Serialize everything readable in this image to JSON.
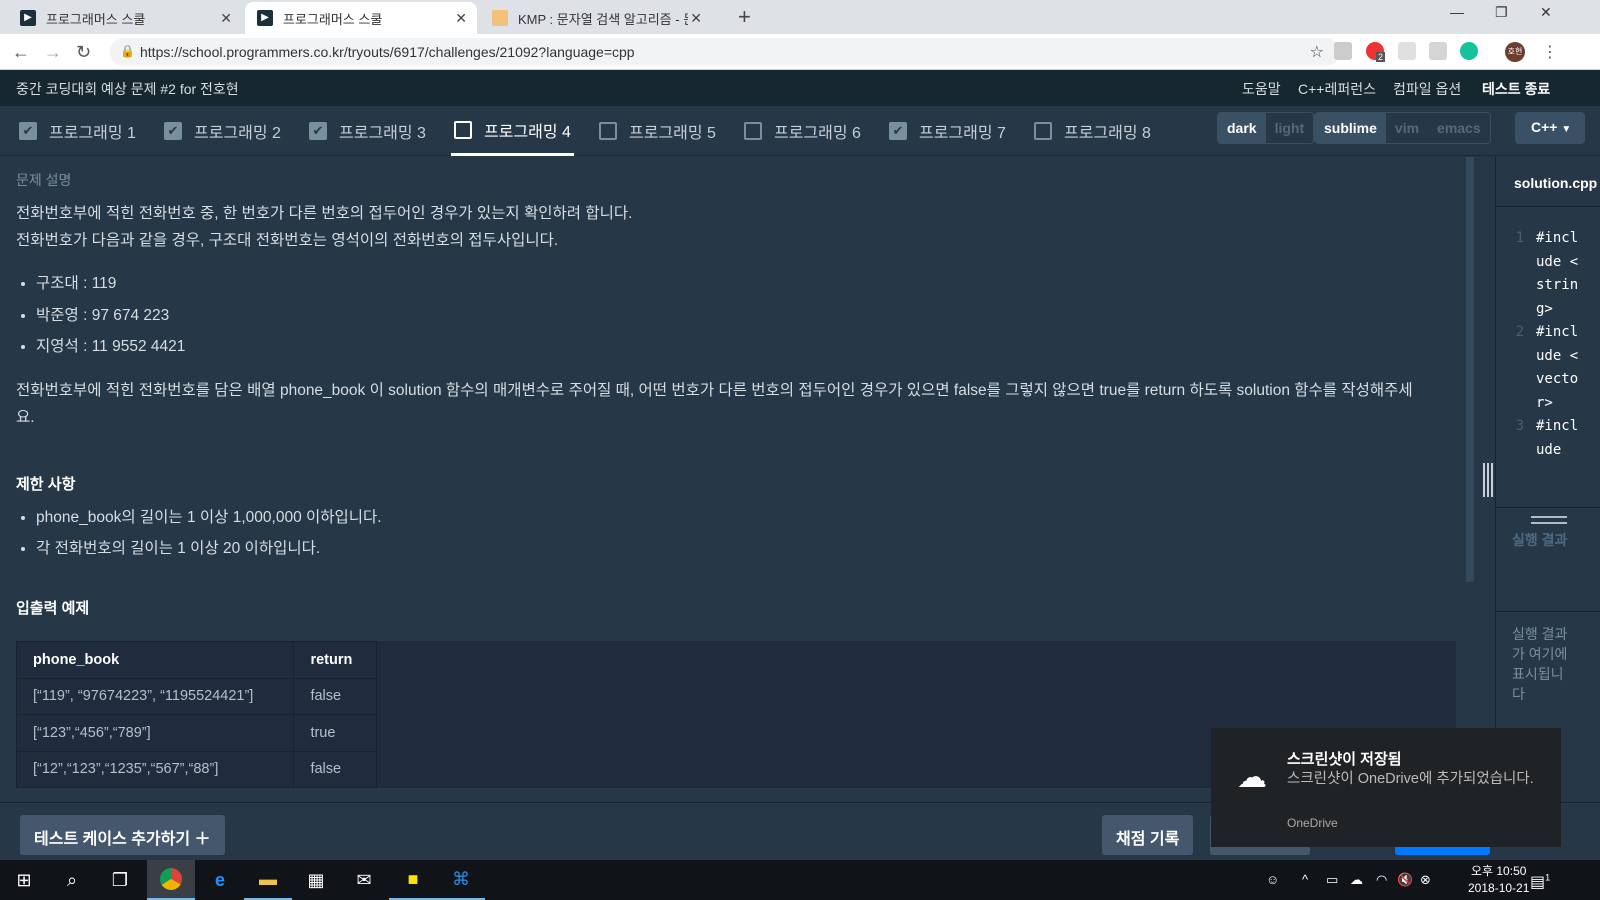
{
  "browser": {
    "tabs": [
      {
        "title": "프로그래머스 스쿨",
        "active": false
      },
      {
        "title": "프로그래머스 스쿨",
        "active": true
      },
      {
        "title": "KMP : 문자열 검색 알고리즘 - 문",
        "active": false
      }
    ],
    "url": "https://school.programmers.co.kr/tryouts/6917/challenges/21092?language=cpp",
    "profile": "호현",
    "ext_badge": "2"
  },
  "header": {
    "title": "중간 코딩대회 예상 문제 #2 for 전호현",
    "menu": [
      "도움말",
      "C++레퍼런스",
      "컴파일 옵션",
      "테스트 종료"
    ]
  },
  "problem_tabs": [
    {
      "label": "프로그래밍 1",
      "checked": true
    },
    {
      "label": "프로그래밍 2",
      "checked": true
    },
    {
      "label": "프로그래밍 3",
      "checked": true
    },
    {
      "label": "프로그래밍 4",
      "checked": false,
      "active": true
    },
    {
      "label": "프로그래밍 5",
      "checked": false
    },
    {
      "label": "프로그래밍 6",
      "checked": false
    },
    {
      "label": "프로그래밍 7",
      "checked": true
    },
    {
      "label": "프로그래밍 8",
      "checked": false
    }
  ],
  "theme": {
    "options": [
      "dark",
      "light"
    ],
    "selected": "dark"
  },
  "keymap": {
    "options": [
      "sublime",
      "vim",
      "emacs"
    ],
    "selected": "sublime"
  },
  "language": "C++",
  "content": {
    "section": "문제 설명",
    "p1": "전화번호부에 적힌 전화번호 중, 한 번호가 다른 번호의 접두어인 경우가 있는지 확인하려 합니다.",
    "p2": "전화번호가 다음과 같을 경우, 구조대 전화번호는 영석이의 전화번호의 접두사입니다.",
    "bullets": [
      "구조대 : 119",
      "박준영 : 97 674 223",
      "지영석 : 11 9552 4421"
    ],
    "p3": "전화번호부에 적힌 전화번호를 담은 배열 phone_book 이 solution 함수의 매개변수로 주어질 때, 어떤 번호가 다른 번호의 접두어인 경우가 있으면 false를 그렇지 않으면 true를 return 하도록 solution 함수를 작성해주세요.",
    "constraints_title": "제한 사항",
    "constraints": [
      "phone_book의 길이는 1 이상 1,000,000 이하입니다.",
      "각 전화번호의 길이는 1 이상 20 이하입니다."
    ],
    "examples_title": "입출력 예제",
    "table": {
      "headers": [
        "phone_book",
        "return"
      ],
      "rows": [
        [
          "[“119”, “97674223”, “1195524421”]",
          "false"
        ],
        [
          "[“123”,“456”,“789”]",
          "true"
        ],
        [
          "[“12”,“123”,“1235”,“567”,“88”]",
          "false"
        ]
      ]
    }
  },
  "editor": {
    "filename": "solution.cpp",
    "lines": [
      {
        "n": "1",
        "code": "#include <string>"
      },
      {
        "n": "2",
        "code": "#include <vector>"
      },
      {
        "n": "3",
        "code": "#include"
      }
    ],
    "result_label": "실행 결과",
    "result_msg": "실행 결과가 여기에 표시됩니다"
  },
  "bottom": {
    "add_test": "테스트 케이스 추가하기 ＋",
    "history": "채점 기록"
  },
  "toast": {
    "title": "스크린샷이 저장됨",
    "body": "스크린샷이 OneDrive에 추가되었습니다.",
    "source": "OneDrive"
  },
  "clock": {
    "time": "오후 10:50",
    "date": "2018-10-21"
  },
  "notif_count": "1"
}
